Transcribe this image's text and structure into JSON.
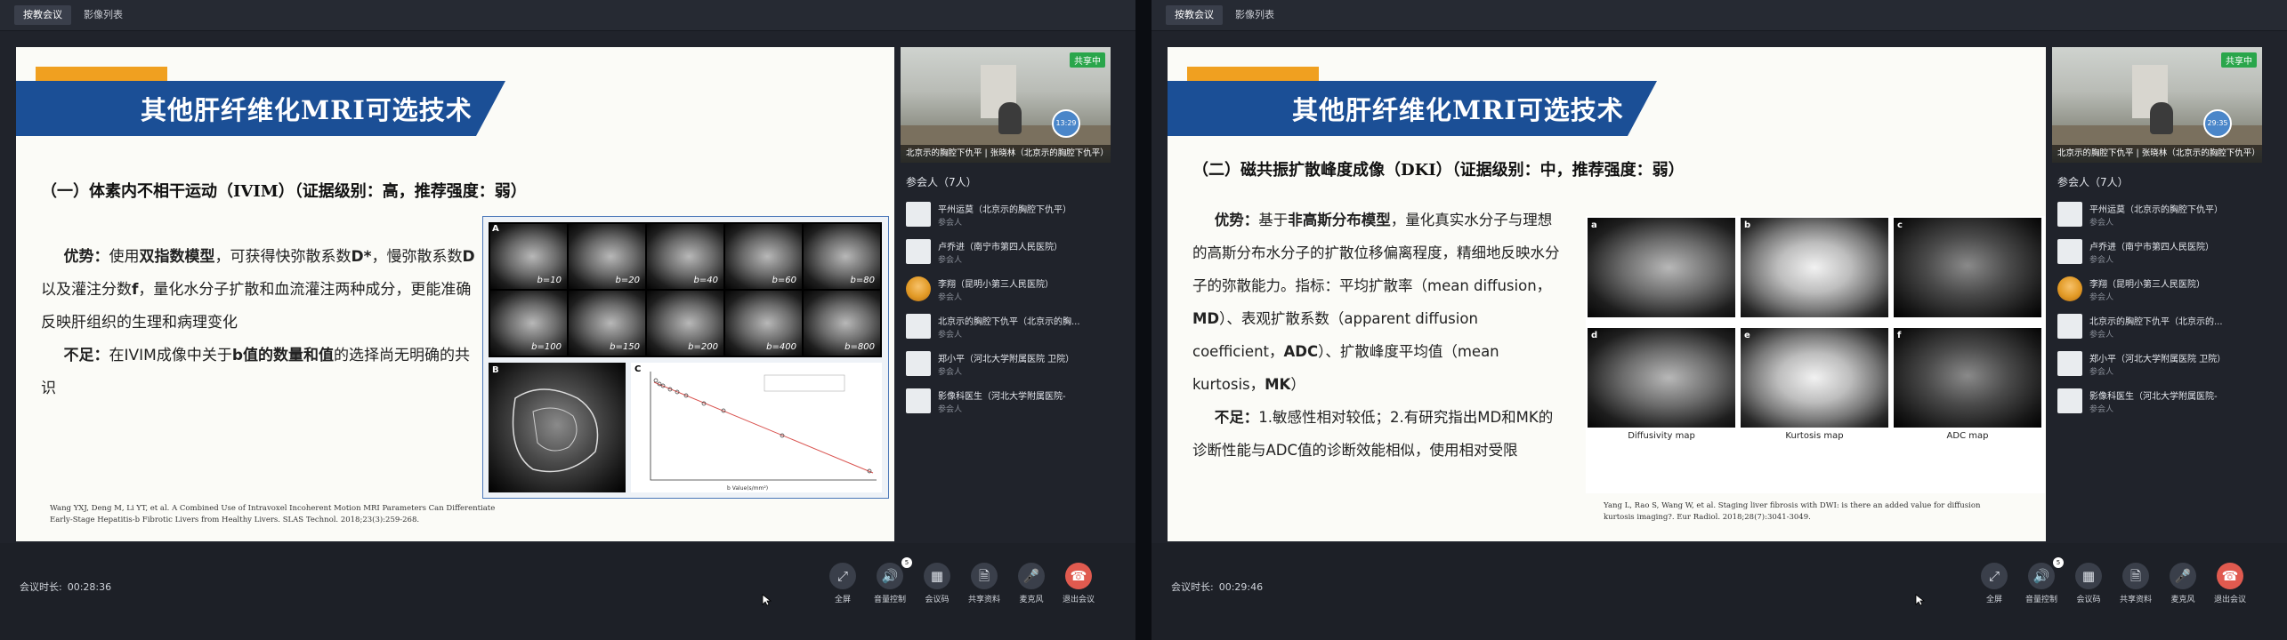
{
  "windows": [
    {
      "tabs": [
        "按教会议",
        "影像列表"
      ],
      "slide": {
        "title": "其他肝纤维化MRI可选技术",
        "section": "（一）体素内不相干运动（IVIM）（证据级别：高，推荐强度：弱）",
        "adv_label": "优势：",
        "adv_text_1": "使用",
        "adv_bold_1": "双指数模型",
        "adv_text_2": "，可获得快弥散系数",
        "adv_bold_2": "D*",
        "adv_text_3": "，慢弥散系数",
        "adv_bold_3": "D",
        "adv_text_4": "以及灌注分数",
        "adv_bold_4": "f",
        "adv_text_5": "，量化水分子扩散和血流灌注两种成分，更能准确反映肝组织的生理和病理变化",
        "dis_label": "不足：",
        "dis_text_1": "在IVIM成像中关于",
        "dis_bold_1": "b值的数量和值",
        "dis_text_2": "的选择尚无明确的共识",
        "reference": "Wang YXJ, Deng M, Li YT, et al. A Combined Use of Intravoxel Incoherent Motion MRI Parameters Can Differentiate Early-Stage Hepatitis-b Fibrotic Livers from Healthy Livers. SLAS Technol. 2018;23(3):259-268.",
        "figure": {
          "panel_a_letter": "A",
          "b_values": [
            "b=10",
            "b=20",
            "b=40",
            "b=60",
            "b=80",
            "b=100",
            "b=150",
            "b=200",
            "b=400",
            "b=800"
          ],
          "panel_b_letter": "B",
          "panel_c_letter": "C",
          "chart_xlabel": "b Value(s/mm²)",
          "chart_ylabel": "Log(SI)"
        }
      },
      "sidebar": {
        "share_badge": "共享中",
        "video_name": "北京示的胸腔下仇平 | 张晓林（北京示的胸腔下仇平）",
        "clock": "13:29",
        "participants_count": "参会人（7人）",
        "participants": [
          {
            "name": "平州运莫（北京示的胸腔下仇平）",
            "role": "参会人"
          },
          {
            "name": "卢乔进（南宁市第四人民医院）",
            "role": "参会人"
          },
          {
            "name": "李翔（昆明小第三人民医院）",
            "role": "参会人"
          },
          {
            "name": "北京示的胸腔下仇平（北京示的胸...",
            "role": "参会人"
          },
          {
            "name": "郑小平（河北大学附属医院 卫院）",
            "role": "参会人"
          },
          {
            "name": "影像科医生（河北大学附属医院-",
            "role": "参会人"
          }
        ]
      },
      "bottom": {
        "duration_label": "会议时长:",
        "duration": "00:28:36",
        "controls": [
          {
            "label": "全屏",
            "icon": "⤢"
          },
          {
            "label": "音量控制",
            "icon": "🔊",
            "badge": "5"
          },
          {
            "label": "会议码",
            "icon": "▦"
          },
          {
            "label": "共享资料",
            "icon": "🗎"
          },
          {
            "label": "麦克风",
            "icon": "🎤"
          },
          {
            "label": "退出会议",
            "icon": "☎"
          }
        ]
      }
    },
    {
      "tabs": [
        "按教会议",
        "影像列表"
      ],
      "slide": {
        "title": "其他肝纤维化MRI可选技术",
        "section": "（二）磁共振扩散峰度成像（DKI）（证据级别：中，推荐强度：弱）",
        "adv_label": "优势：",
        "adv_text_1": "基于",
        "adv_bold_1": "非高斯分布模型",
        "adv_text_2": "，量化真实水分子与理想的高斯分布水分子的扩散位移偏离程度，精细地反映水分子的弥散能力。指标：平均扩散率（mean diffusion，",
        "adv_bold_2": "MD",
        "adv_text_3": "）、表观扩散系数（apparent diffusion coefficient，",
        "adv_bold_3": "ADC",
        "adv_text_4": "）、扩散峰度平均值（mean kurtosis，",
        "adv_bold_4": "MK",
        "adv_text_5": "）",
        "dis_label": "不足：",
        "dis_text_1": "1.敏感性相对较低；2.有研究指出MD和MK的诊断性能与ADC值的诊断效能相似，使用相对受限",
        "reference": "Yang L, Rao S, Wang W, et al. Staging liver fibrosis with DWI: is there an added value for diffusion kurtosis imaging?. Eur Radiol. 2018;28(7):3041-3049.",
        "figure": {
          "panels": [
            "a",
            "b",
            "c",
            "d",
            "e",
            "f"
          ],
          "captions": [
            "Diffusivity map",
            "Kurtosis map",
            "ADC map"
          ]
        }
      },
      "sidebar": {
        "share_badge": "共享中",
        "video_name": "北京示的胸腔下仇平 | 张晓林（北京示的胸腔下仇平）",
        "clock": "29:35",
        "participants_count": "参会人（7人）",
        "participants": [
          {
            "name": "平州运莫（北京示的胸腔下仇平）",
            "role": "参会人"
          },
          {
            "name": "卢乔进（南宁市第四人民医院）",
            "role": "参会人"
          },
          {
            "name": "李翔（昆明小第三人民医院）",
            "role": "参会人"
          },
          {
            "name": "北京示的胸腔下仇平（北京示的...",
            "role": "参会人"
          },
          {
            "name": "郑小平（河北大学附属医院 卫院）",
            "role": "参会人"
          },
          {
            "name": "影像科医生（河北大学附属医院-",
            "role": "参会人"
          }
        ]
      },
      "bottom": {
        "duration_label": "会议时长:",
        "duration": "00:29:46",
        "controls": [
          {
            "label": "全屏",
            "icon": "⤢"
          },
          {
            "label": "音量控制",
            "icon": "🔊",
            "badge": "5"
          },
          {
            "label": "会议码",
            "icon": "▦"
          },
          {
            "label": "共享资料",
            "icon": "🗎"
          },
          {
            "label": "麦克风",
            "icon": "🎤"
          },
          {
            "label": "退出会议",
            "icon": "☎"
          }
        ]
      }
    }
  ]
}
